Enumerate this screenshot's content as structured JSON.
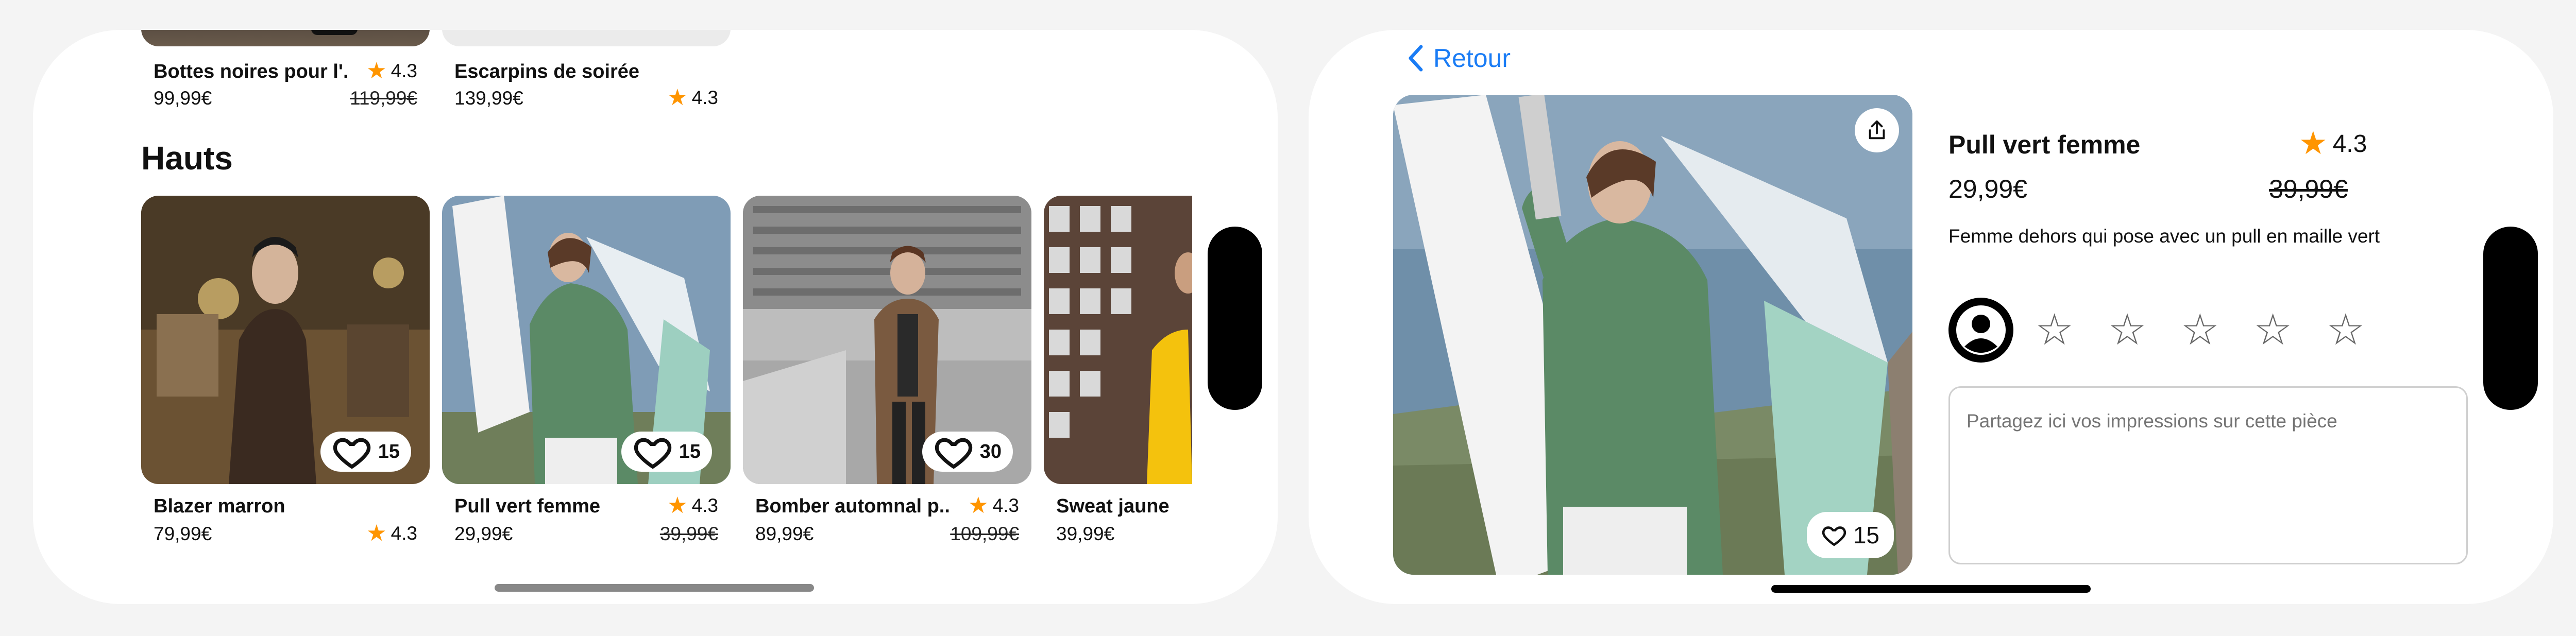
{
  "left_screen": {
    "top_row": [
      {
        "name": "Bottes noires pour l'...",
        "price": "99,99€",
        "old_price": "119,99€",
        "rating": "4.3"
      },
      {
        "name": "Escarpins de soirée",
        "price": "139,99€",
        "rating": "4.3"
      }
    ],
    "section_title": "Hauts",
    "products": [
      {
        "name": "Blazer marron",
        "price": "79,99€",
        "rating": "4.3",
        "likes": "15"
      },
      {
        "name": "Pull vert femme",
        "price": "29,99€",
        "old_price": "39,99€",
        "rating": "4.3",
        "likes": "15"
      },
      {
        "name": "Bomber automnal p...",
        "price": "89,99€",
        "old_price": "109,99€",
        "rating": "4.3",
        "likes": "30"
      },
      {
        "name": "Sweat jaune",
        "price": "39,99€"
      }
    ]
  },
  "detail_screen": {
    "back_label": "Retour",
    "title": "Pull vert femme",
    "rating": "4.3",
    "price": "29,99€",
    "old_price": "39,99€",
    "description": "Femme dehors qui pose avec un pull en maille vert",
    "likes": "15",
    "review_placeholder": "Partagez ici vos impressions sur cette pièce",
    "star_count": 5
  },
  "colors": {
    "accent": "#1a7cf5",
    "star": "#ff9500",
    "background": "#f4f4f4",
    "pull_green": "#5b8a66"
  },
  "icons": [
    "star-icon",
    "heart-icon",
    "chevron-left-icon",
    "share-icon",
    "user-avatar-icon",
    "empty-star-icon"
  ]
}
